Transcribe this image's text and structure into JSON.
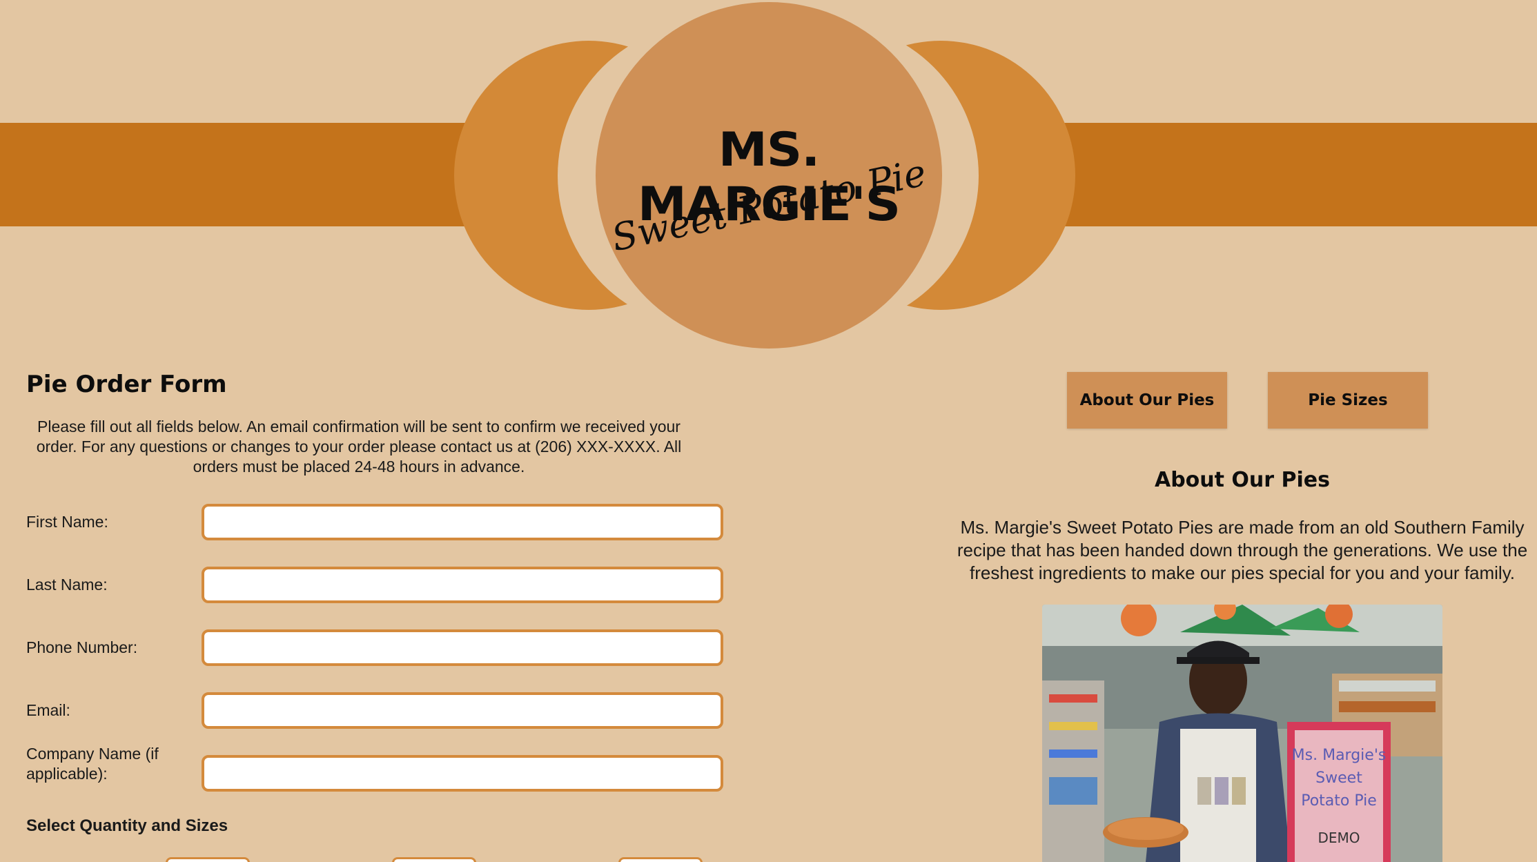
{
  "brand": {
    "title": "MS. MARGIE'S",
    "subtitle": "Sweet Potato Pie"
  },
  "form": {
    "heading": "Pie Order Form",
    "intro": "Please fill out all fields below. An email confirmation will be sent to confirm we received your order. For any questions or changes to your order please contact us at (206) XXX-XXXX. All orders must be placed 24-48 hours in advance.",
    "fields": [
      {
        "label": "First Name:",
        "value": ""
      },
      {
        "label": "Last Name:",
        "value": ""
      },
      {
        "label": "Phone Number:",
        "value": ""
      },
      {
        "label": "Email:",
        "value": ""
      },
      {
        "label": "Company Name (if applicable):",
        "value": ""
      }
    ],
    "quantity_heading": "Select Quantity and Sizes"
  },
  "nav": {
    "about_label": "About Our Pies",
    "sizes_label": "Pie Sizes"
  },
  "about": {
    "heading": "About Our Pies",
    "text": "Ms. Margie's Sweet Potato Pies are made from an old Southern Family recipe that has been handed down through the generations. We use the freshest ingredients to make our pies special for you and your family.",
    "photo_sign_line1": "Ms. Margie's",
    "photo_sign_line2": "Sweet",
    "photo_sign_line3": "Potato Pie",
    "photo_sign_line4": "DEMO"
  },
  "colors": {
    "background": "#e3c6a2",
    "band": "#c4731b",
    "accent": "#d38937",
    "logo_circle": "#cf9056",
    "input_border": "#d48a3c"
  }
}
